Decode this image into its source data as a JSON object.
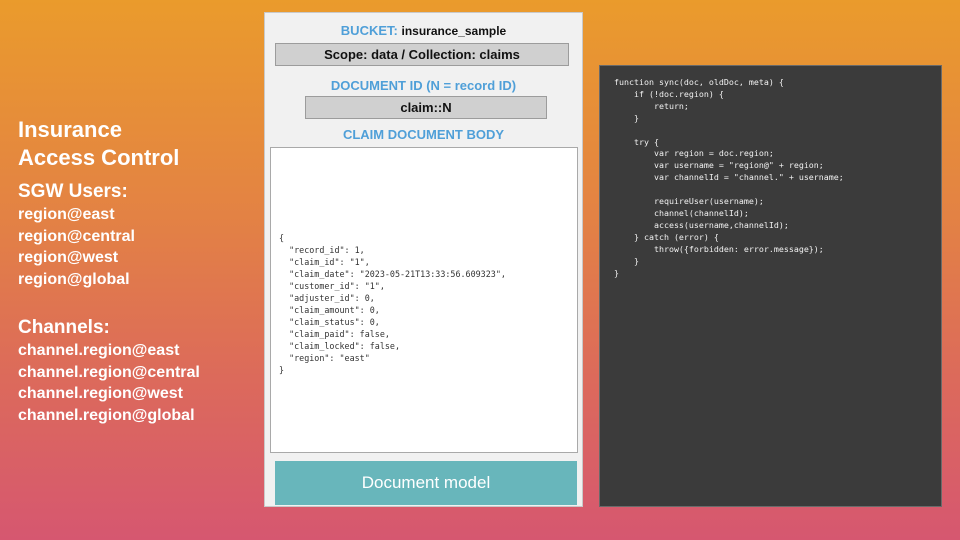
{
  "left": {
    "title_line1": "Insurance",
    "title_line2": "Access Control",
    "users_heading": "SGW Users:",
    "users": [
      "region@east",
      "region@central",
      "region@west",
      "region@global"
    ],
    "channels_heading": "Channels:",
    "channels": [
      "channel.region@east",
      "channel.region@central",
      "channel.region@west",
      "channel.region@global"
    ]
  },
  "panel": {
    "bucket_label": "BUCKET:",
    "bucket_value": "insurance_sample",
    "scope_text": "Scope: data / Collection: claims",
    "doc_id_label": "DOCUMENT ID (N = record ID)",
    "doc_id_value": "claim::N",
    "body_label": "CLAIM DOCUMENT BODY",
    "json_lines": [
      "{",
      "  \"record_id\": 1,",
      "  \"claim_id\": \"1\",",
      "  \"claim_date\": \"2023-05-21T13:33:56.609323\",",
      "  \"customer_id\": \"1\",",
      "  \"adjuster_id\": 0,",
      "  \"claim_amount\": 0,",
      "  \"claim_status\": 0,",
      "  \"claim_paid\": false,",
      "  \"claim_locked\": false,",
      "  \"region\": \"east\"",
      "}"
    ],
    "button_label": "Document model"
  },
  "code_lines": [
    "function sync(doc, oldDoc, meta) {",
    "    if (!doc.region) {",
    "        return;",
    "    }",
    "",
    "    try {",
    "        var region = doc.region;",
    "        var username = \"region@\" + region;",
    "        var channelId = \"channel.\" + username;",
    "",
    "        requireUser(username);",
    "        channel(channelId);",
    "        access(username,channelId);",
    "    } catch (error) {",
    "        throw({forbidden: error.message});",
    "    }",
    "}"
  ]
}
